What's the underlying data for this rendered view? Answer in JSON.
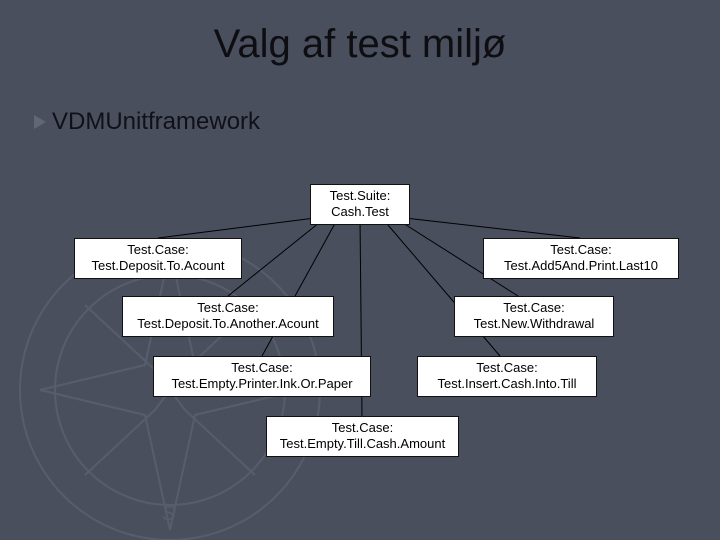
{
  "title": "Valg af test miljø",
  "bullet": {
    "term": "VDMUnit",
    "rest": " framework"
  },
  "nodes": {
    "suite": {
      "label1": "Test.Suite:",
      "label2": "Cash.Test"
    },
    "tc_deposit": {
      "label1": "Test.Case:",
      "label2": "Test.Deposit.To.Acount"
    },
    "tc_add5": {
      "label1": "Test.Case:",
      "label2": "Test.Add5And.Print.Last10"
    },
    "tc_deposit_another": {
      "label1": "Test.Case:",
      "label2": "Test.Deposit.To.Another.Acount"
    },
    "tc_new_withdrawal": {
      "label1": "Test.Case:",
      "label2": "Test.New.Withdrawal"
    },
    "tc_empty_printer": {
      "label1": "Test.Case:",
      "label2": "Test.Empty.Printer.Ink.Or.Paper"
    },
    "tc_insert_cash": {
      "label1": "Test.Case:",
      "label2": "Test.Insert.Cash.Into.Till"
    },
    "tc_empty_till": {
      "label1": "Test.Case:",
      "label2": "Test.Empty.Till.Cash.Amount"
    }
  },
  "chart_data": {
    "type": "tree",
    "title": "Valg af test miljø",
    "root": "Test.Suite: Cash.Test",
    "children": [
      "Test.Case: Test.Deposit.To.Acount",
      "Test.Case: Test.Add5And.Print.Last10",
      "Test.Case: Test.Deposit.To.Another.Acount",
      "Test.Case: Test.New.Withdrawal",
      "Test.Case: Test.Empty.Printer.Ink.Or.Paper",
      "Test.Case: Test.Insert.Cash.Into.Till",
      "Test.Case: Test.Empty.Till.Cash.Amount"
    ]
  }
}
